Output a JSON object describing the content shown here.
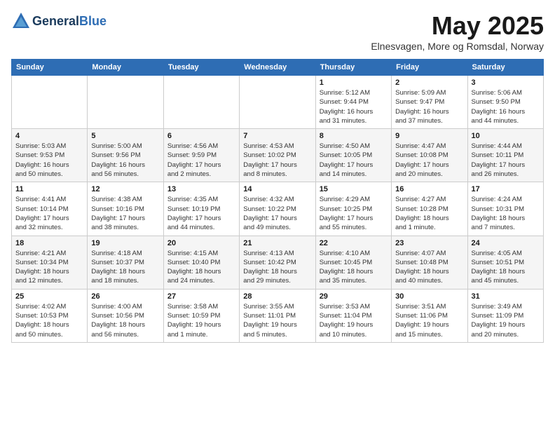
{
  "header": {
    "logo_general": "General",
    "logo_blue": "Blue",
    "title": "May 2025",
    "subtitle": "Elnesvagen, More og Romsdal, Norway"
  },
  "calendar": {
    "days_of_week": [
      "Sunday",
      "Monday",
      "Tuesday",
      "Wednesday",
      "Thursday",
      "Friday",
      "Saturday"
    ],
    "weeks": [
      [
        {
          "day": "",
          "info": ""
        },
        {
          "day": "",
          "info": ""
        },
        {
          "day": "",
          "info": ""
        },
        {
          "day": "",
          "info": ""
        },
        {
          "day": "1",
          "info": "Sunrise: 5:12 AM\nSunset: 9:44 PM\nDaylight: 16 hours\nand 31 minutes."
        },
        {
          "day": "2",
          "info": "Sunrise: 5:09 AM\nSunset: 9:47 PM\nDaylight: 16 hours\nand 37 minutes."
        },
        {
          "day": "3",
          "info": "Sunrise: 5:06 AM\nSunset: 9:50 PM\nDaylight: 16 hours\nand 44 minutes."
        }
      ],
      [
        {
          "day": "4",
          "info": "Sunrise: 5:03 AM\nSunset: 9:53 PM\nDaylight: 16 hours\nand 50 minutes."
        },
        {
          "day": "5",
          "info": "Sunrise: 5:00 AM\nSunset: 9:56 PM\nDaylight: 16 hours\nand 56 minutes."
        },
        {
          "day": "6",
          "info": "Sunrise: 4:56 AM\nSunset: 9:59 PM\nDaylight: 17 hours\nand 2 minutes."
        },
        {
          "day": "7",
          "info": "Sunrise: 4:53 AM\nSunset: 10:02 PM\nDaylight: 17 hours\nand 8 minutes."
        },
        {
          "day": "8",
          "info": "Sunrise: 4:50 AM\nSunset: 10:05 PM\nDaylight: 17 hours\nand 14 minutes."
        },
        {
          "day": "9",
          "info": "Sunrise: 4:47 AM\nSunset: 10:08 PM\nDaylight: 17 hours\nand 20 minutes."
        },
        {
          "day": "10",
          "info": "Sunrise: 4:44 AM\nSunset: 10:11 PM\nDaylight: 17 hours\nand 26 minutes."
        }
      ],
      [
        {
          "day": "11",
          "info": "Sunrise: 4:41 AM\nSunset: 10:14 PM\nDaylight: 17 hours\nand 32 minutes."
        },
        {
          "day": "12",
          "info": "Sunrise: 4:38 AM\nSunset: 10:16 PM\nDaylight: 17 hours\nand 38 minutes."
        },
        {
          "day": "13",
          "info": "Sunrise: 4:35 AM\nSunset: 10:19 PM\nDaylight: 17 hours\nand 44 minutes."
        },
        {
          "day": "14",
          "info": "Sunrise: 4:32 AM\nSunset: 10:22 PM\nDaylight: 17 hours\nand 49 minutes."
        },
        {
          "day": "15",
          "info": "Sunrise: 4:29 AM\nSunset: 10:25 PM\nDaylight: 17 hours\nand 55 minutes."
        },
        {
          "day": "16",
          "info": "Sunrise: 4:27 AM\nSunset: 10:28 PM\nDaylight: 18 hours\nand 1 minute."
        },
        {
          "day": "17",
          "info": "Sunrise: 4:24 AM\nSunset: 10:31 PM\nDaylight: 18 hours\nand 7 minutes."
        }
      ],
      [
        {
          "day": "18",
          "info": "Sunrise: 4:21 AM\nSunset: 10:34 PM\nDaylight: 18 hours\nand 12 minutes."
        },
        {
          "day": "19",
          "info": "Sunrise: 4:18 AM\nSunset: 10:37 PM\nDaylight: 18 hours\nand 18 minutes."
        },
        {
          "day": "20",
          "info": "Sunrise: 4:15 AM\nSunset: 10:40 PM\nDaylight: 18 hours\nand 24 minutes."
        },
        {
          "day": "21",
          "info": "Sunrise: 4:13 AM\nSunset: 10:42 PM\nDaylight: 18 hours\nand 29 minutes."
        },
        {
          "day": "22",
          "info": "Sunrise: 4:10 AM\nSunset: 10:45 PM\nDaylight: 18 hours\nand 35 minutes."
        },
        {
          "day": "23",
          "info": "Sunrise: 4:07 AM\nSunset: 10:48 PM\nDaylight: 18 hours\nand 40 minutes."
        },
        {
          "day": "24",
          "info": "Sunrise: 4:05 AM\nSunset: 10:51 PM\nDaylight: 18 hours\nand 45 minutes."
        }
      ],
      [
        {
          "day": "25",
          "info": "Sunrise: 4:02 AM\nSunset: 10:53 PM\nDaylight: 18 hours\nand 50 minutes."
        },
        {
          "day": "26",
          "info": "Sunrise: 4:00 AM\nSunset: 10:56 PM\nDaylight: 18 hours\nand 56 minutes."
        },
        {
          "day": "27",
          "info": "Sunrise: 3:58 AM\nSunset: 10:59 PM\nDaylight: 19 hours\nand 1 minute."
        },
        {
          "day": "28",
          "info": "Sunrise: 3:55 AM\nSunset: 11:01 PM\nDaylight: 19 hours\nand 5 minutes."
        },
        {
          "day": "29",
          "info": "Sunrise: 3:53 AM\nSunset: 11:04 PM\nDaylight: 19 hours\nand 10 minutes."
        },
        {
          "day": "30",
          "info": "Sunrise: 3:51 AM\nSunset: 11:06 PM\nDaylight: 19 hours\nand 15 minutes."
        },
        {
          "day": "31",
          "info": "Sunrise: 3:49 AM\nSunset: 11:09 PM\nDaylight: 19 hours\nand 20 minutes."
        }
      ]
    ]
  }
}
